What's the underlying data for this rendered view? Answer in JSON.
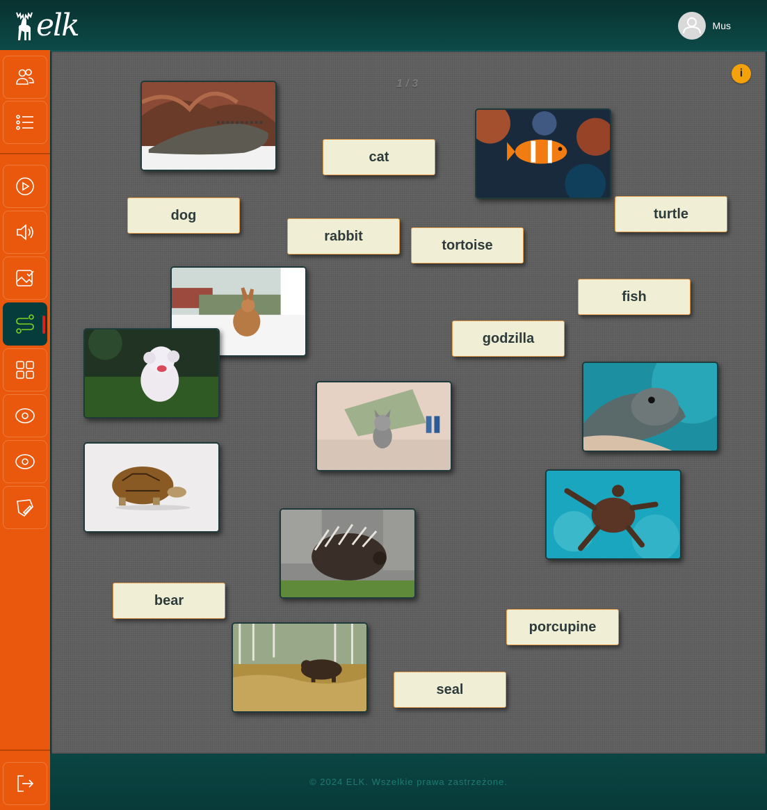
{
  "app": {
    "logo_text": "elk"
  },
  "user": {
    "name": "Mus"
  },
  "sidebar": {
    "items": [
      {
        "icon": "users-icon"
      },
      {
        "icon": "list-icon"
      },
      {
        "icon": "play-icon"
      },
      {
        "icon": "speaker-icon"
      },
      {
        "icon": "image-check-icon"
      },
      {
        "icon": "route-icon",
        "active": true
      },
      {
        "icon": "grid-icon"
      },
      {
        "icon": "eye-icon"
      },
      {
        "icon": "eye-icon"
      },
      {
        "icon": "edit-shape-icon"
      }
    ],
    "logout_icon": "logout-icon"
  },
  "board": {
    "page_indicator": "1 / 3",
    "info_label": "i",
    "words": {
      "cat": "cat",
      "dog": "dog",
      "rabbit": "rabbit",
      "tortoise": "tortoise",
      "turtle": "turtle",
      "fish": "fish",
      "godzilla": "godzilla",
      "bear": "bear",
      "porcupine": "porcupine",
      "seal": "seal"
    },
    "photos": [
      "iguana",
      "clownfish",
      "rabbit",
      "dog",
      "kitten",
      "seal",
      "tortoise",
      "sea-turtle",
      "porcupine",
      "bear"
    ]
  },
  "footer": {
    "copyright": "© 2024 ELK. Wszelkie prawa zastrzeżone."
  },
  "colors": {
    "accent": "#e9580d",
    "header": "#063c3c",
    "card": "#f0eed5",
    "card_border": "#e39b47",
    "info": "#f5a10a"
  }
}
